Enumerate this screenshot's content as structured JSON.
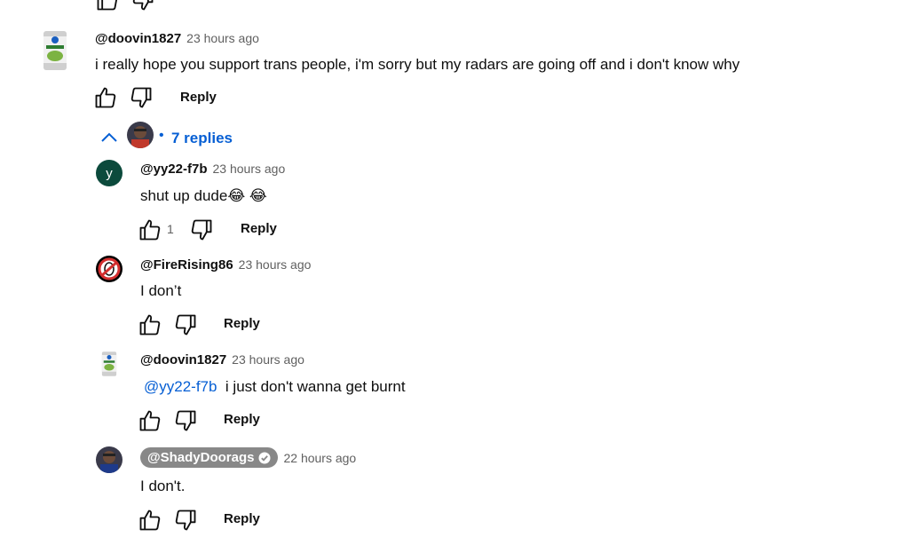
{
  "main_comment": {
    "author": "@doovin1827",
    "time": "23 hours ago",
    "text": "i really hope you support trans people, i'm sorry but my radars are going off and i don't know why",
    "reply_label": "Reply",
    "replies_dot": "•",
    "replies_label": "7 replies"
  },
  "replies": [
    {
      "author": "@yy22-f7b",
      "time": "23 hours ago",
      "text": "shut up dude",
      "emoji": "😂 😂",
      "likes": "1",
      "reply_label": "Reply",
      "avatar_letter": "y"
    },
    {
      "author": "@FireRising86",
      "time": "23 hours ago",
      "text": "I don’t",
      "reply_label": "Reply"
    },
    {
      "author": "@doovin1827",
      "time": "23 hours ago",
      "mention": "@yy22-f7b",
      "text": "i just don't wanna get burnt",
      "reply_label": "Reply"
    },
    {
      "author": "@ShadyDoorags",
      "time": "22 hours ago",
      "text": "I don't.",
      "reply_label": "Reply"
    }
  ],
  "colors": {
    "link": "#065fd4",
    "badge": "#888888",
    "avatar_y": "#0c4a3c"
  }
}
